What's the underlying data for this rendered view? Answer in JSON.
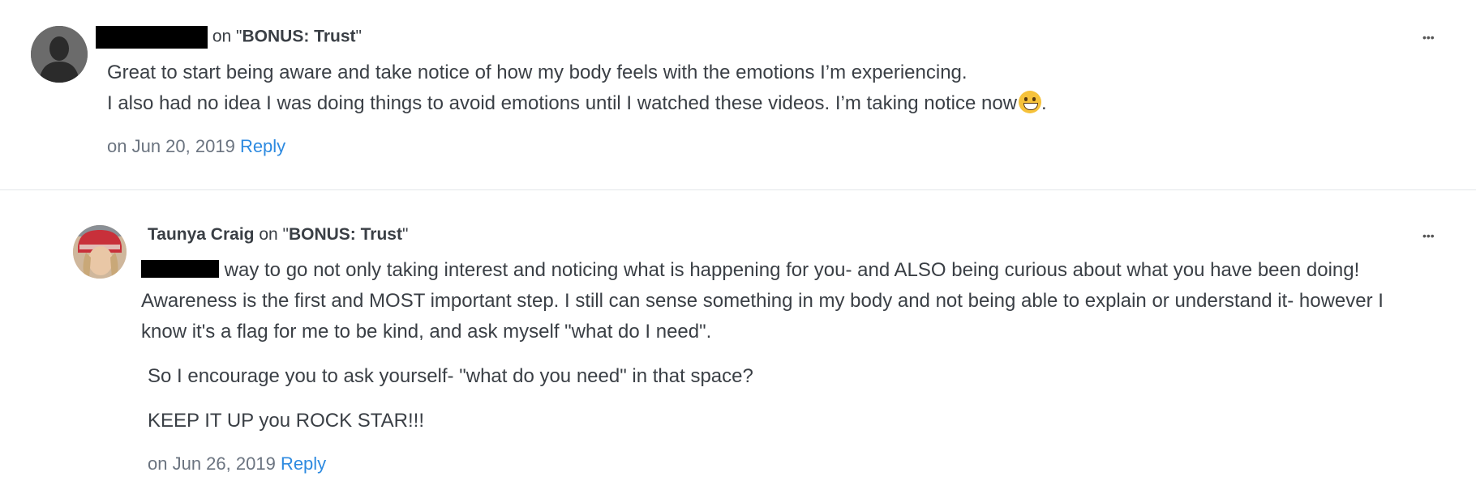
{
  "comments": [
    {
      "author": "",
      "on_text": " on \"",
      "topic": "BONUS: Trust",
      "close_quote": "\"",
      "lines": [
        "Great to start being aware and take notice of how my body feels with the emotions I’m experiencing.",
        "I also had no idea I was doing things to avoid emotions until I watched these videos. I’m taking notice now",
        "."
      ],
      "date": "on Jun 20, 2019",
      "reply_label": "Reply",
      "more_label": "•••"
    },
    {
      "author": "Taunya Craig",
      "on_text": " on \"",
      "topic": "BONUS: Trust",
      "close_quote": "\"",
      "para1_tail": " way to go not only taking interest and noticing what is happening for you- and ALSO being curious about what you have been doing! Awareness is the first and MOST important step. I still can sense something in my body and not being able to explain or understand it- however I know it's a flag for me to be kind, and ask myself \"what do I need\".",
      "para2": "So I encourage you to ask yourself- \"what do you need\" in that space?",
      "para3": "KEEP IT UP you ROCK STAR!!!",
      "date": "on Jun 26, 2019",
      "reply_label": "Reply",
      "more_label": "•••"
    }
  ]
}
